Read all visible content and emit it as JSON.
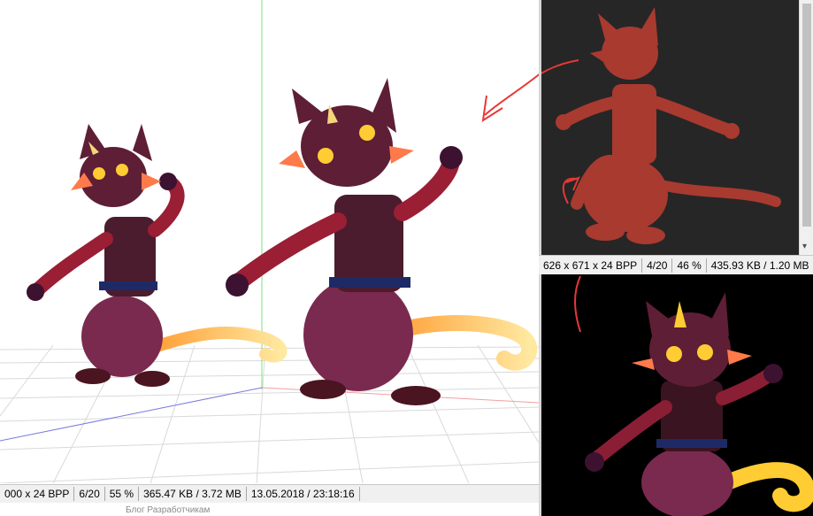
{
  "left_viewer": {
    "status": {
      "dims": "000 x 24 BPP",
      "index": "6/20",
      "zoom": "55 %",
      "size": "365.47 KB / 3.72 MB",
      "datetime": "13.05.2018 / 23:18:16"
    },
    "below_text": "Блог   Разработчикам"
  },
  "right_top_viewer": {
    "status": {
      "dims": "626 x 671 x 24 BPP",
      "index": "4/20",
      "zoom": "46 %",
      "size": "435.93 KB / 1.20 MB"
    }
  },
  "colors": {
    "annotation_arrow": "#e53935",
    "dark_bg": "#262626",
    "black_bg": "#000000"
  },
  "icons": {
    "scroll_down": "▾"
  }
}
